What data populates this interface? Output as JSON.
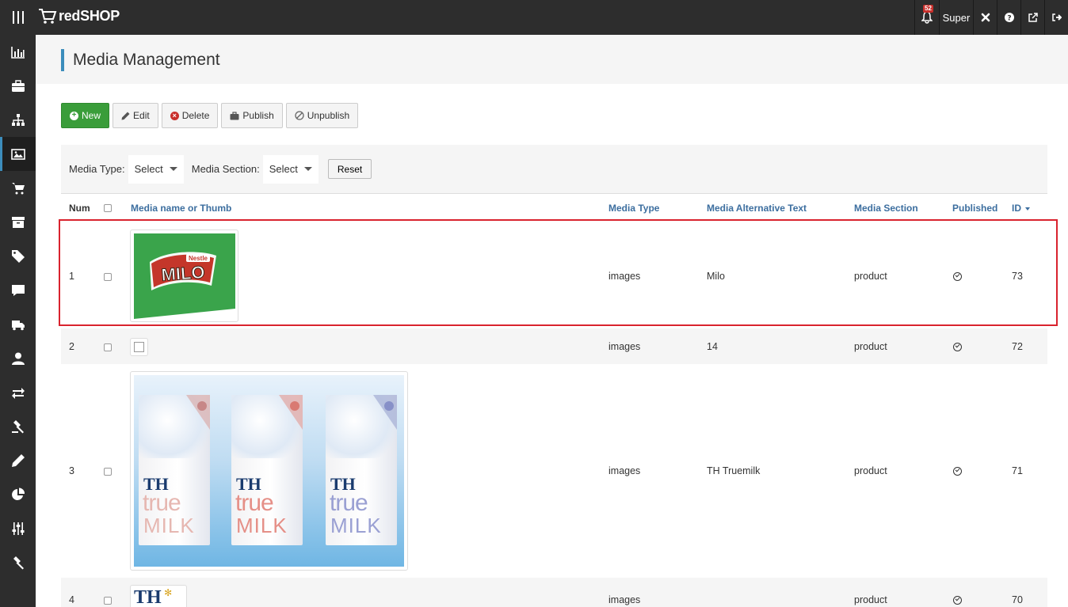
{
  "topbar": {
    "brand": "redSHOP",
    "notification_count": "52",
    "user_label": "Super",
    "icons": [
      "joomla-icon",
      "help-icon",
      "external-link-icon",
      "logout-icon"
    ]
  },
  "sidebar": {
    "items": [
      {
        "icon": "bar-chart-icon",
        "active": false
      },
      {
        "icon": "briefcase-icon",
        "active": false
      },
      {
        "icon": "sitemap-icon",
        "active": false
      },
      {
        "icon": "image-icon",
        "active": true
      },
      {
        "icon": "cart-icon",
        "active": false
      },
      {
        "icon": "archive-icon",
        "active": false
      },
      {
        "icon": "tag-icon",
        "active": false
      },
      {
        "icon": "comment-icon",
        "active": false
      },
      {
        "icon": "truck-icon",
        "active": false
      },
      {
        "icon": "user-icon",
        "active": false
      },
      {
        "icon": "exchange-icon",
        "active": false
      },
      {
        "icon": "gavel-icon",
        "active": false
      },
      {
        "icon": "pencil-icon",
        "active": false
      },
      {
        "icon": "pie-chart-icon",
        "active": false
      },
      {
        "icon": "sliders-icon",
        "active": false
      },
      {
        "icon": "hammer-icon",
        "active": false
      }
    ]
  },
  "page": {
    "title": "Media Management"
  },
  "toolbar": {
    "new": "New",
    "edit": "Edit",
    "delete": "Delete",
    "publish": "Publish",
    "unpublish": "Unpublish"
  },
  "filters": {
    "media_type_label": "Media Type:",
    "media_type_value": "Select",
    "media_section_label": "Media Section:",
    "media_section_value": "Select",
    "reset": "Reset"
  },
  "table": {
    "headers": {
      "num": "Num",
      "name": "Media name or Thumb",
      "type": "Media Type",
      "alt": "Media Alternative Text",
      "section": "Media Section",
      "published": "Published",
      "id": "ID"
    },
    "rows": [
      {
        "num": "1",
        "type": "images",
        "alt": "Milo",
        "section": "product",
        "published": true,
        "id": "73",
        "thumb": "milo-logo"
      },
      {
        "num": "2",
        "type": "images",
        "alt": "14",
        "section": "product",
        "published": true,
        "id": "72",
        "thumb": "blank"
      },
      {
        "num": "3",
        "type": "images",
        "alt": "TH Truemilk",
        "section": "product",
        "published": true,
        "id": "71",
        "thumb": "th-truemilk-cartons"
      },
      {
        "num": "4",
        "type": "images",
        "alt": "",
        "section": "product",
        "published": true,
        "id": "70",
        "thumb": "th-logo"
      }
    ]
  },
  "thumbs": {
    "milo_brand": "MILO",
    "milo_maker": "Nestle",
    "th_logo": "TH",
    "true_word": "true",
    "milk_word": "MILK"
  },
  "colors": {
    "accent": "#3c8dbc",
    "sidebar_bg": "#2d2d2d",
    "new_button": "#3a9d3a",
    "highlight": "#d9232e",
    "link_header": "#3c6e9f"
  }
}
